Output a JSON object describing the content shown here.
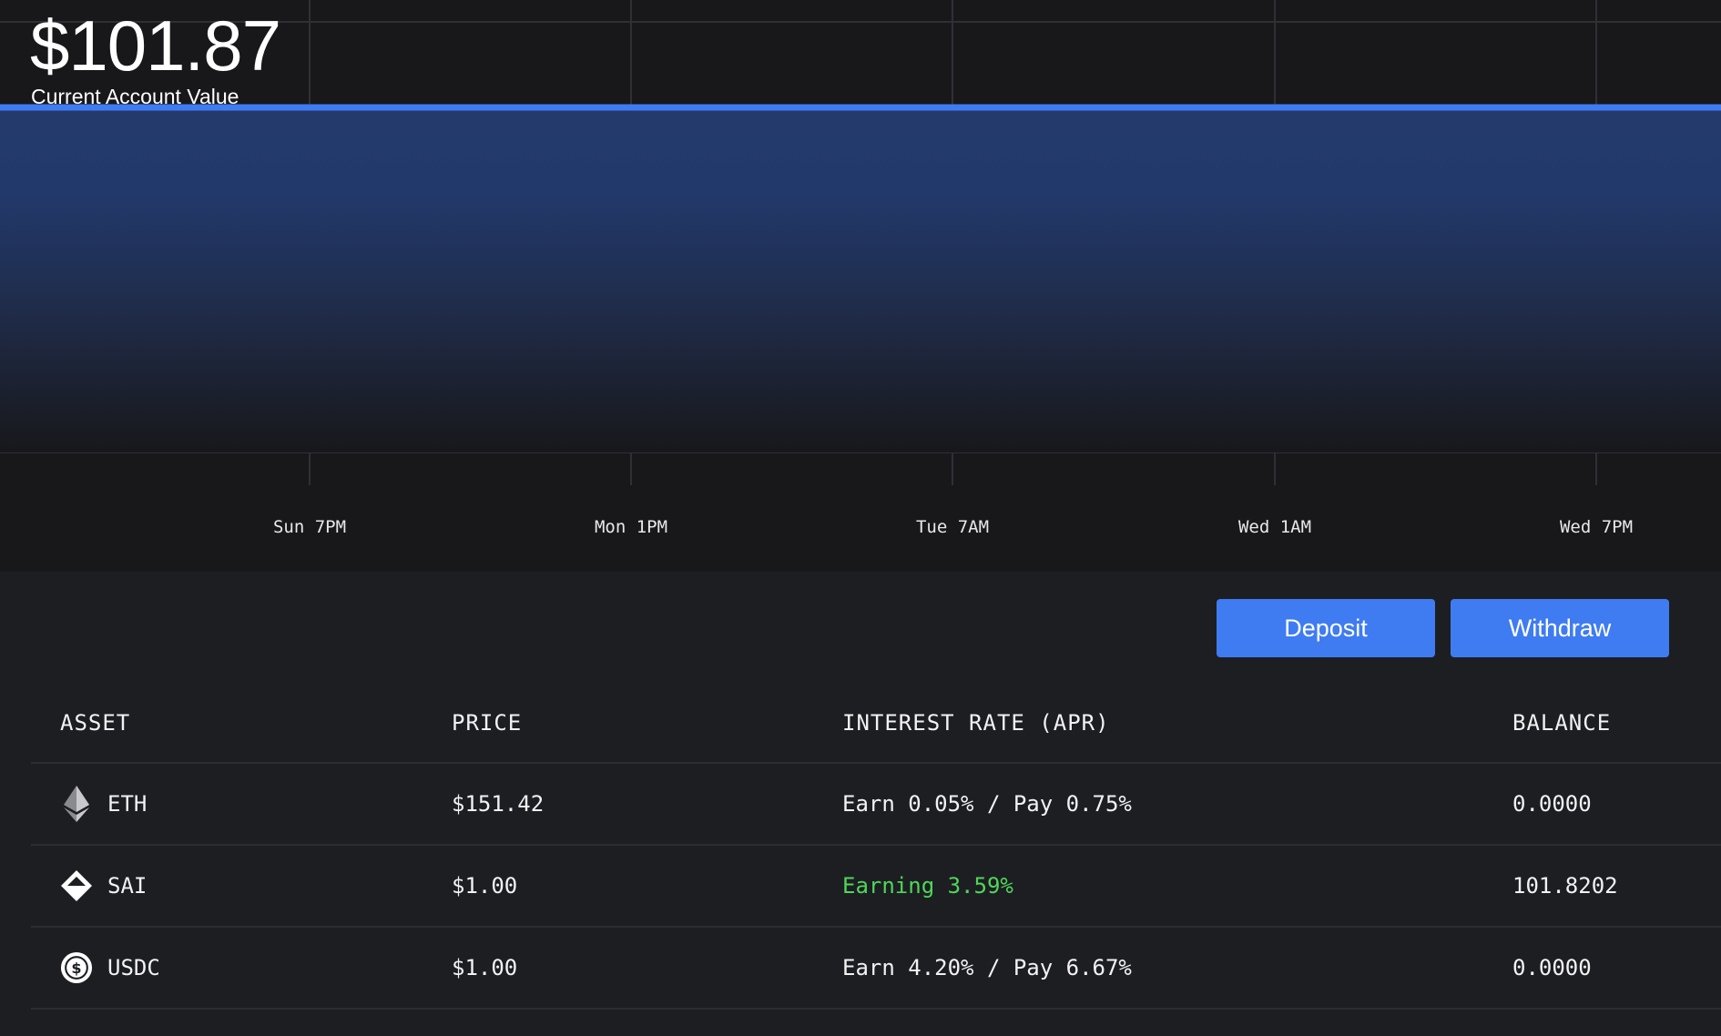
{
  "header": {
    "account_value": "$101.87",
    "caption": "Current Account Value"
  },
  "chart_data": {
    "type": "area",
    "title": "",
    "xlabel": "",
    "ylabel": "",
    "x_tick_labels": [
      "Sun 7PM",
      "Mon 1PM",
      "Tue 7AM",
      "Wed 1AM",
      "Wed 7PM"
    ],
    "series": [
      {
        "values": [
          101.87,
          101.87,
          101.87,
          101.87,
          101.87,
          101.87
        ]
      }
    ],
    "grid": true,
    "line_color": "#3f7cf2"
  },
  "actions": {
    "deposit_label": "Deposit",
    "withdraw_label": "Withdraw"
  },
  "table": {
    "headers": {
      "asset": "ASSET",
      "price": "PRICE",
      "rate": "INTEREST RATE (APR)",
      "balance": "BALANCE"
    },
    "rows": [
      {
        "icon": "eth-icon",
        "asset": "ETH",
        "price": "$151.42",
        "rate": "Earn 0.05% / Pay 0.75%",
        "balance": "0.0000"
      },
      {
        "icon": "sai-icon",
        "asset": "SAI",
        "price": "$1.00",
        "rate": "Earning 3.59%",
        "balance": "101.8202"
      },
      {
        "icon": "usdc-icon",
        "asset": "USDC",
        "price": "$1.00",
        "rate": "Earn 4.20% / Pay 6.67%",
        "balance": "0.0000"
      }
    ]
  },
  "colors": {
    "accent": "#3f7cf2",
    "earning_green": "#4fd65a",
    "background": "#1d1e22",
    "chart_background": "#18181b"
  }
}
